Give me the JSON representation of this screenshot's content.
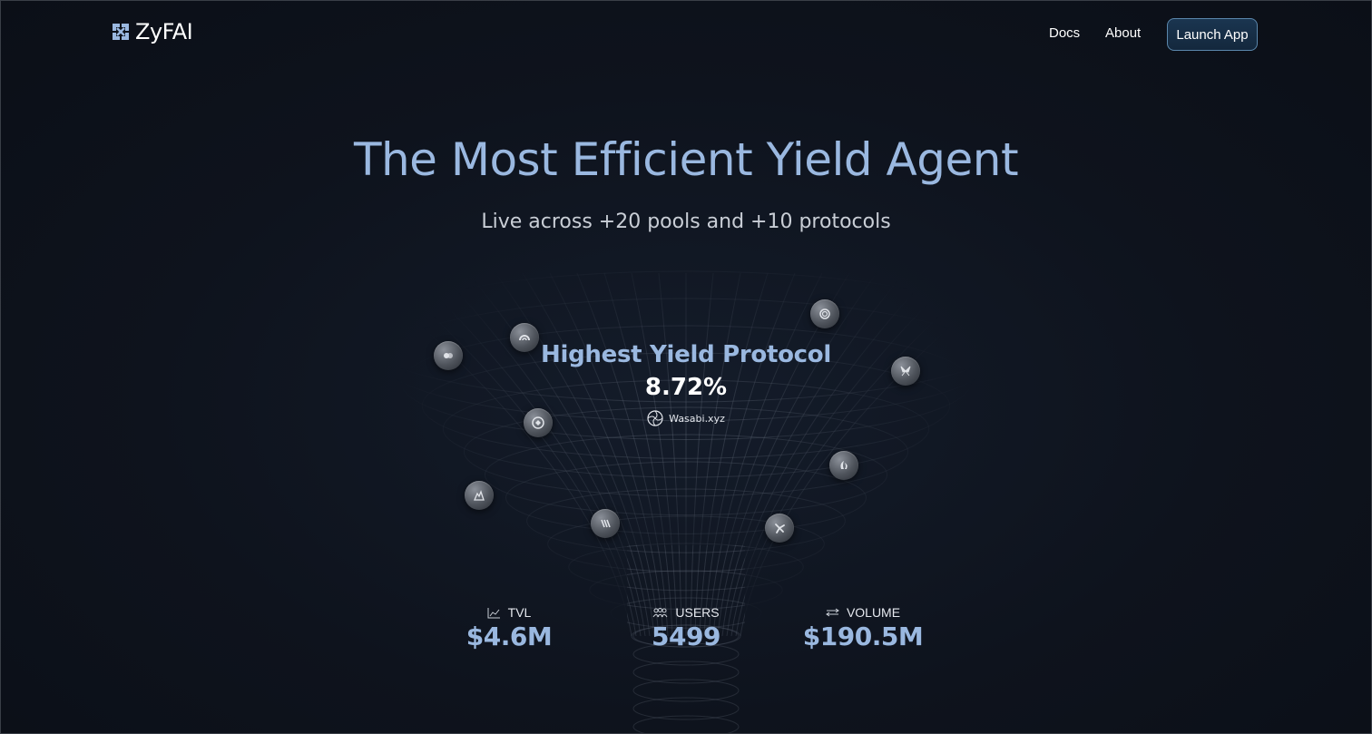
{
  "header": {
    "logo_text": "ZyFAI",
    "nav": {
      "docs": "Docs",
      "about": "About"
    },
    "launch_label": "Launch App"
  },
  "hero": {
    "title": "The Most Efficient Yield Agent",
    "subtitle": "Live across +20 pools and +10 protocols"
  },
  "highlight": {
    "title": "Highest Yield Protocol",
    "value": "8.72%",
    "protocol_name": "Wasabi.xyz",
    "protocol_icon": "wasabi-logo-icon"
  },
  "protocol_coins": [
    {
      "icon": "protocol-coin-icon-1"
    },
    {
      "icon": "protocol-coin-icon-2"
    },
    {
      "icon": "protocol-coin-icon-3"
    },
    {
      "icon": "protocol-coin-icon-4"
    },
    {
      "icon": "protocol-coin-icon-5"
    },
    {
      "icon": "protocol-coin-icon-6"
    },
    {
      "icon": "protocol-coin-icon-7"
    },
    {
      "icon": "protocol-coin-icon-8"
    },
    {
      "icon": "protocol-coin-icon-9"
    },
    {
      "icon": "protocol-coin-icon-10"
    }
  ],
  "stats": {
    "tvl": {
      "label": "TVL",
      "value": "$4.6M",
      "icon": "chart-icon"
    },
    "users": {
      "label": "USERS",
      "value": "5499",
      "icon": "users-icon"
    },
    "volume": {
      "label": "VOLUME",
      "value": "$190.5M",
      "icon": "arrows-icon"
    }
  },
  "colors": {
    "background": "#0d121c",
    "accent": "#9ab8e0",
    "button_border": "#5b87ac"
  }
}
